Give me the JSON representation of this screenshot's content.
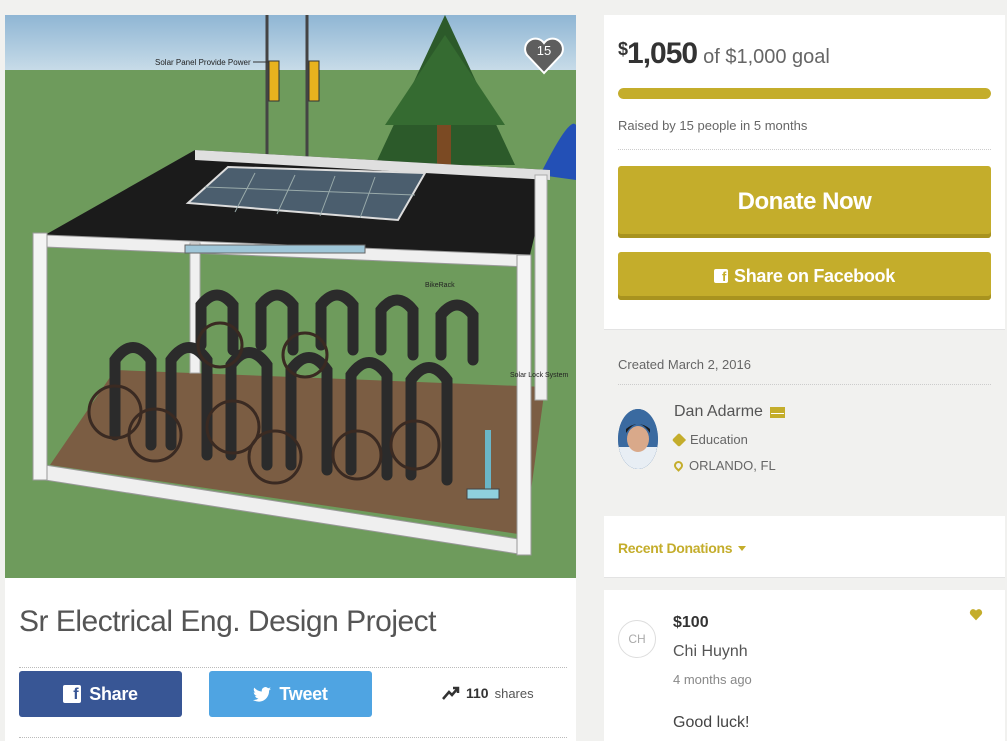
{
  "campaign": {
    "title": "Sr Electrical Eng. Design Project",
    "heart_count": "15",
    "image_labels": {
      "solar": "Solar Panel Provide Power",
      "rack": "BikeRack",
      "lock": "Solar Lock System"
    }
  },
  "share_bar": {
    "share_label": "Share",
    "tweet_label": "Tweet",
    "share_count": "110",
    "shares_word": "shares"
  },
  "funding": {
    "raised_currency": "$",
    "raised_amount": "1,050",
    "goal_text": "of $1,000 goal",
    "progress_fraction": 1.0,
    "raised_by": "Raised by 15 people in 5 months",
    "donate_label": "Donate Now",
    "fb_share_label": "Share on Facebook"
  },
  "organizer": {
    "created": "Created March 2, 2016",
    "name": "Dan Adarme",
    "category": "Education",
    "location": "ORLANDO, FL"
  },
  "recent": {
    "label": "Recent Donations",
    "donation": {
      "initials": "CH",
      "amount": "$100",
      "name": "Chi Huynh",
      "time": "4 months ago",
      "message": "Good luck!"
    }
  },
  "colors": {
    "accent": "#c4ad2b",
    "facebook": "#385695",
    "twitter": "#4fa4e2"
  }
}
